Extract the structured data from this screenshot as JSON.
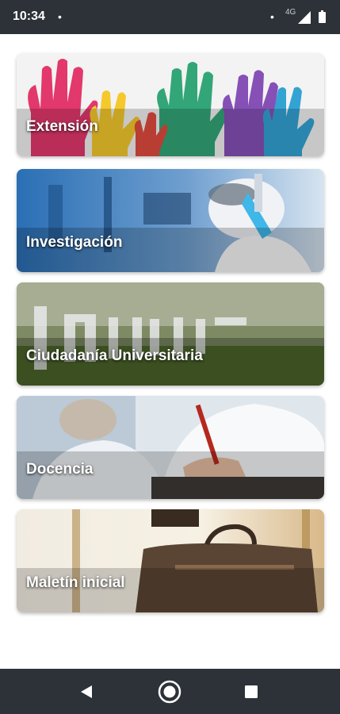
{
  "status_bar": {
    "time": "10:34",
    "network_label": "4G",
    "icons": [
      "notification-dot-icon",
      "signal-icon",
      "battery-icon"
    ]
  },
  "menu": {
    "cards": [
      {
        "label": "Extensión",
        "image": "colorful-hands-image"
      },
      {
        "label": "Investigación",
        "image": "lab-scientist-image"
      },
      {
        "label": "Ciudadanía Universitaria",
        "image": "uncuyo-sign-image"
      },
      {
        "label": "Docencia",
        "image": "doctor-writing-image"
      },
      {
        "label": "Maletín inicial",
        "image": "briefcase-image"
      }
    ]
  },
  "nav_bar": {
    "icons": [
      "back-icon",
      "home-icon",
      "recents-icon"
    ]
  },
  "colors": {
    "system_bar": "#2c3238",
    "background": "#ffffff",
    "label_text": "#ffffff"
  }
}
